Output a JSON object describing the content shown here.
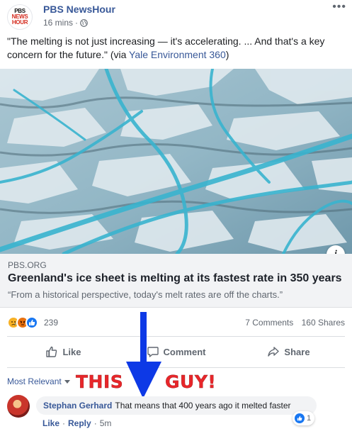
{
  "post": {
    "page_name": "PBS NewsHour",
    "logo_lines": [
      "PBS",
      "NEWS",
      "HOUR"
    ],
    "time": "16 mins",
    "meta_sep": "·",
    "more_icon": "more-horizontal-icon",
    "status_text": "\"The melting is not just increasing — it's accelerating. ... And that's a key concern for the future.\" (via ",
    "status_link": "Yale Environment 360",
    "status_end": ")"
  },
  "link_card": {
    "domain": "PBS.ORG",
    "title": "Greenland's ice sheet is melting at its fastest rate in 350 years",
    "description": "“From a historical perspective, today's melt rates are off the charts.”",
    "info_icon": "i"
  },
  "reactions": {
    "icons": [
      "sad-reaction-icon",
      "angry-reaction-icon",
      "like-reaction-icon"
    ],
    "count": "239",
    "comments": "7 Comments",
    "shares": "160 Shares"
  },
  "actions": {
    "like": "Like",
    "comment": "Comment",
    "share": "Share"
  },
  "comments_section": {
    "sort_label": "Most Relevant",
    "overlay_left": "THIS",
    "overlay_right": "GUY!",
    "comment": {
      "author": "Stephan Gerhard",
      "text": "That means that 400 years ago it melted faster",
      "like_count": "1",
      "like_label": "Like",
      "reply_label": "Reply",
      "sep": "·",
      "time": "5m"
    }
  },
  "colors": {
    "link_blue": "#385898",
    "overlay_red": "#e8262a",
    "arrow_blue": "#0d39e6",
    "like_blue": "#1877f2"
  }
}
